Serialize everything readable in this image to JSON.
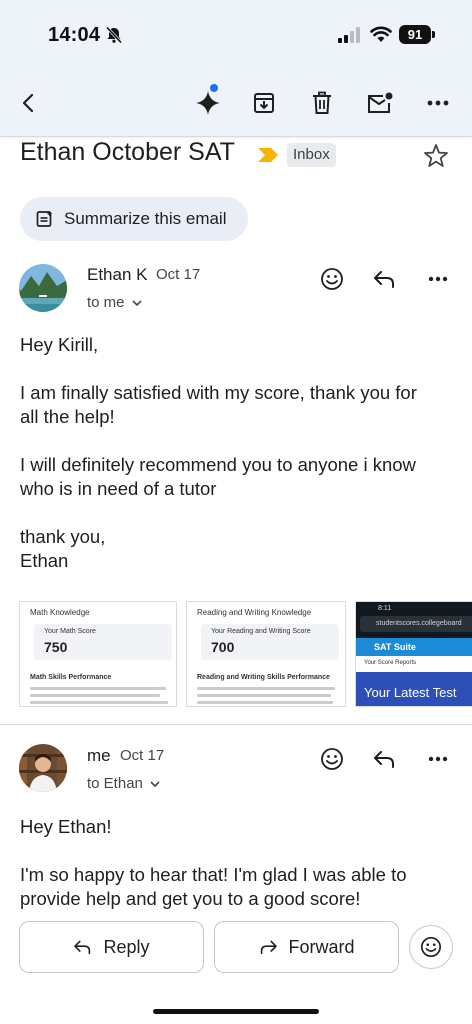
{
  "status_bar": {
    "time": "14:04",
    "battery": "91"
  },
  "toolbar": {
    "icons": [
      "back-icon",
      "gemini-icon",
      "archive-icon",
      "delete-icon",
      "mark-unread-icon",
      "more-icon"
    ]
  },
  "thread": {
    "subject": "Ethan October SAT",
    "label": "Inbox",
    "summarize_label": "Summarize this email"
  },
  "messages": [
    {
      "sender": "Ethan K",
      "date": "Oct 17",
      "recipient": "to me",
      "body": [
        "Hey Kirill,",
        "I am finally satisfied with my score, thank you for",
        "all the help!",
        "I will definitely recommend you to anyone i know",
        "who is in need of a tutor",
        "thank you,",
        "Ethan"
      ],
      "attachments": [
        {
          "title": "Math Knowledge",
          "score_label": "Your Math Score",
          "score": "750",
          "section": "Math Skills Performance"
        },
        {
          "title": "Reading and Writing Knowledge",
          "score_label": "Your Reading and Writing Score",
          "score": "700",
          "section": "Reading and Writing Skills Performance"
        },
        {
          "time": "8:11",
          "url": "studentscores.collegeboard",
          "brand": "SAT Suite",
          "subtitle": "Your Score Reports",
          "banner": "Your Latest Test"
        }
      ]
    },
    {
      "sender": "me",
      "date": "Oct 17",
      "recipient": "to Ethan",
      "body": [
        "Hey Ethan!",
        "I'm so happy to hear that! I'm glad I was able to",
        "provide help and get you to a good score!"
      ]
    }
  ],
  "actions": {
    "reply": "Reply",
    "forward": "Forward"
  },
  "colors": {
    "topbar": "#eef2f9",
    "accent": "#1a73e8",
    "important": "#f5b400",
    "chip": "#e8eaed"
  }
}
